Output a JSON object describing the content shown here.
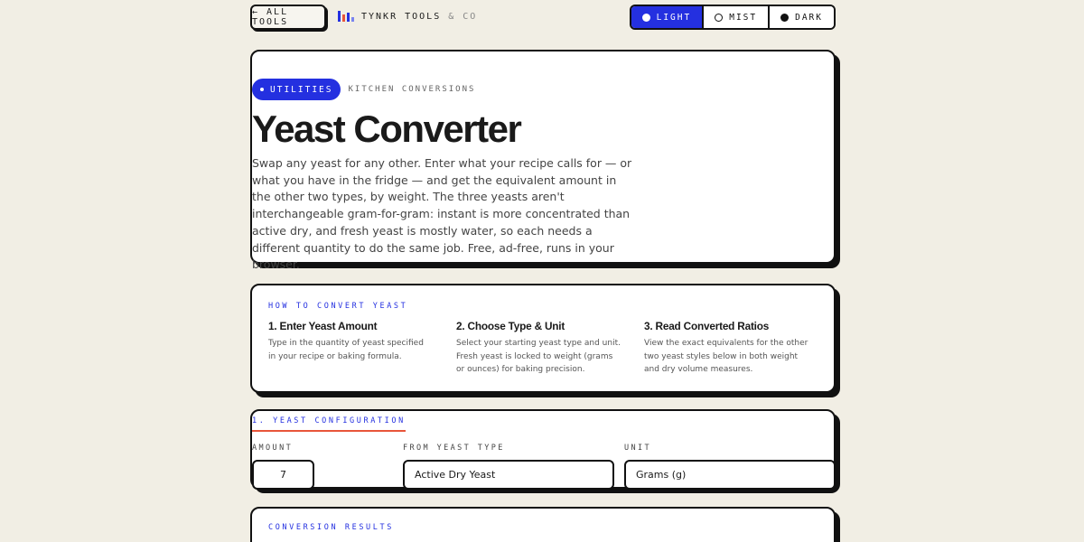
{
  "topbar": {
    "back_label": "← ALL TOOLS",
    "brand_name": "TYNKR TOOLS",
    "brand_suffix": "& CO",
    "brand_logo_colors": [
      "#2430e0",
      "#e8553a",
      "#2430e0",
      "#7a84f0"
    ],
    "theme_options": [
      {
        "label": "LIGHT",
        "icon": "filled-circle-icon",
        "active": true
      },
      {
        "label": "MIST",
        "icon": "ring-circle-icon",
        "active": false
      },
      {
        "label": "DARK",
        "icon": "dark-circle-icon",
        "active": false
      }
    ]
  },
  "hero": {
    "badge": "UTILITIES",
    "crumb": "KITCHEN CONVERSIONS",
    "title": "Yeast Converter",
    "description": "Swap any yeast for any other. Enter what your recipe calls for — or what you have in the fridge — and get the equivalent amount in the other two types, by weight. The three yeasts aren't interchangeable gram-for-gram: instant is more concentrated than active dry, and fresh yeast is mostly water, so each needs a different quantity to do the same job. Free, ad-free, runs in your browser."
  },
  "howto": {
    "label": "HOW TO CONVERT YEAST",
    "steps": [
      {
        "title": "1. Enter Yeast Amount",
        "text": "Type in the quantity of yeast specified in your recipe or baking formula."
      },
      {
        "title": "2. Choose Type & Unit",
        "text": "Select your starting yeast type and unit. Fresh yeast is locked to weight (grams or ounces) for baking precision."
      },
      {
        "title": "3. Read Converted Ratios",
        "text": "View the exact equivalents for the other two yeast styles below in both weight and dry volume measures."
      }
    ]
  },
  "config": {
    "label": "1. YEAST CONFIGURATION",
    "amount_label": "AMOUNT",
    "amount_value": "7",
    "type_label": "FROM YEAST TYPE",
    "type_value": "Active Dry Yeast",
    "unit_label": "UNIT",
    "unit_value": "Grams (g)"
  },
  "results": {
    "label": "CONVERSION RESULTS"
  },
  "colors": {
    "accent": "#2430e0",
    "underline": "#e8553a",
    "background": "#f1eee4"
  }
}
